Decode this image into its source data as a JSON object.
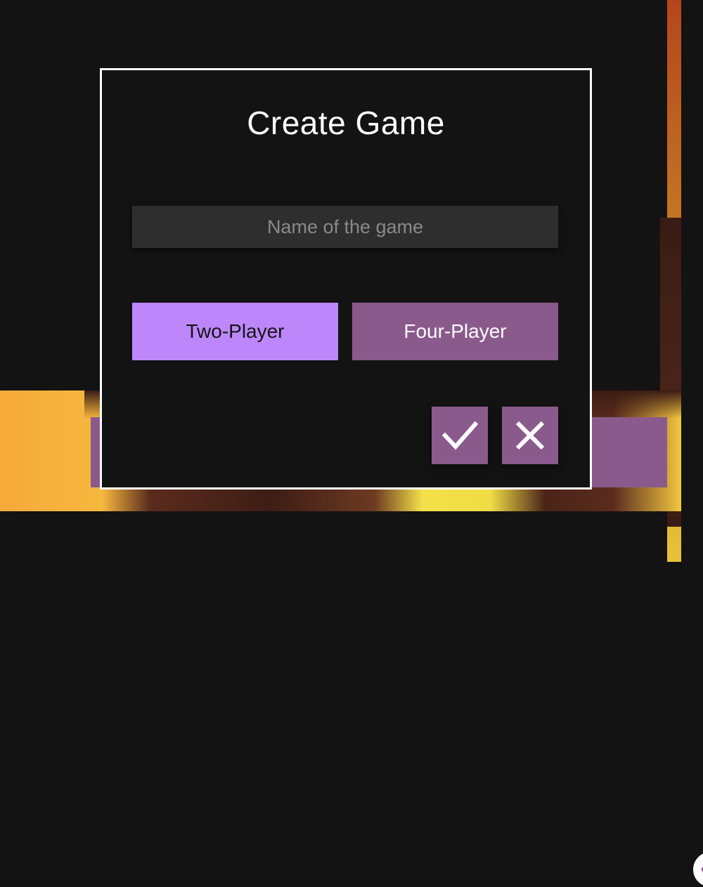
{
  "dialog": {
    "title": "Create Game",
    "name_input": {
      "placeholder": "Name of the game",
      "value": ""
    },
    "modes": [
      {
        "label": "Two-Player",
        "selected": true
      },
      {
        "label": "Four-Player",
        "selected": false
      }
    ],
    "confirm_icon": "checkmark-icon",
    "cancel_icon": "close-icon"
  },
  "background": {
    "panel_icon": "plus-circle-icon"
  },
  "colors": {
    "background": "#131313",
    "accent_selected": "#bd87fb",
    "accent": "#8b5a8c",
    "input_bg": "#2e2e2e",
    "border": "#ffffff"
  }
}
